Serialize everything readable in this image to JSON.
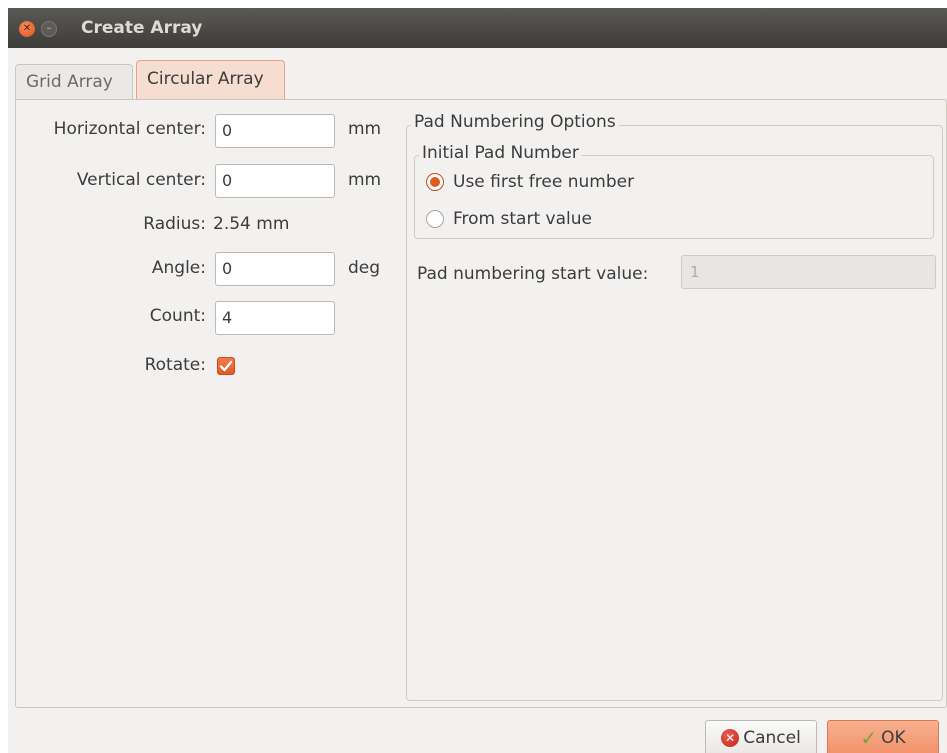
{
  "window": {
    "title": "Create Array"
  },
  "tabs": [
    {
      "label": "Grid Array",
      "active": false
    },
    {
      "label": "Circular Array",
      "active": true
    }
  ],
  "circular": {
    "horizontal_center": {
      "label": "Horizontal center:",
      "value": "0",
      "unit": "mm"
    },
    "vertical_center": {
      "label": "Vertical center:",
      "value": "0",
      "unit": "mm"
    },
    "radius": {
      "label": "Radius:",
      "value": "2.54 mm"
    },
    "angle": {
      "label": "Angle:",
      "value": "0",
      "unit": "deg"
    },
    "count": {
      "label": "Count:",
      "value": "4"
    },
    "rotate": {
      "label": "Rotate:",
      "checked": true
    }
  },
  "pad_numbering": {
    "group_title": "Pad Numbering Options",
    "initial": {
      "group_title": "Initial Pad Number",
      "options": [
        {
          "label": "Use first free number",
          "selected": true
        },
        {
          "label": "From start value",
          "selected": false
        }
      ]
    },
    "start_value": {
      "label": "Pad numbering start value:",
      "value": "1",
      "enabled": false
    }
  },
  "buttons": {
    "cancel": "Cancel",
    "ok": "OK"
  },
  "colors": {
    "accent": "#e0591f",
    "titlebar": "#3d3c38",
    "ok_button": "#f1926a"
  }
}
